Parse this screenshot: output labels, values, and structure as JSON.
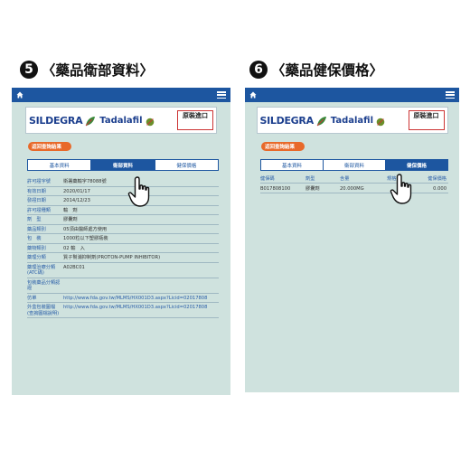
{
  "left_step": {
    "number": "5",
    "title": "〈藥品衛部資料〉"
  },
  "right_step": {
    "number": "6",
    "title": "〈藥品健保價格〉"
  },
  "banner": {
    "brand": "SILDEGRA",
    "product": "Tadalafil",
    "import_label": "原裝進口",
    "accent": "#1c3f8e",
    "import_border": "#cc3333"
  },
  "back_button": {
    "label": "返回查詢結果",
    "color": "#e8692a"
  },
  "tabs": [
    "基本資料",
    "衛部資料",
    "健保價格"
  ],
  "left_panel": {
    "active_tab": 1,
    "rows": [
      {
        "label": "許可證字號",
        "value": "衛署藥輸字78088號"
      },
      {
        "label": "有效日期",
        "value": "2020/01/17"
      },
      {
        "label": "發證日期",
        "value": "2014/12/23"
      },
      {
        "label": "許可證種類",
        "value": "輸　劑"
      },
      {
        "label": "劑　型",
        "value": "膠囊劑"
      },
      {
        "label": "藥品類別",
        "value": "05須由醫師處方使用"
      },
      {
        "label": "包　裝",
        "value": "1000粒以下塑膠瓶裝"
      },
      {
        "label": "藥物類別",
        "value": "02 輸　入"
      },
      {
        "label": "藥理分類",
        "value": "質子幫浦抑制劑(PROTON-PUMP INHIBITOR)"
      },
      {
        "label": "藥理治療分類(ATC碼)",
        "value": "A02BC01"
      },
      {
        "label": "包裝藥品分類認證",
        "value": ""
      },
      {
        "label": "仿單",
        "value": "http://www.fda.gov.tw/MLMS/HX001D3.aspx?Licid=02017808",
        "link": true
      },
      {
        "label": "外盒包裝圖檔(查詢圖檔說明)",
        "value": "http://www.fda.gov.tw/MLMS/HX001D3.aspx?Licid=02017808",
        "link": true
      }
    ]
  },
  "right_panel": {
    "active_tab": 2,
    "headers": [
      "健保碼",
      "劑型",
      "含量",
      "規格量",
      "健保價格"
    ],
    "row": [
      "B017808100",
      "膠囊劑",
      "20.000MG",
      "",
      "0.000"
    ]
  },
  "icons": {
    "home": "home-icon",
    "menu": "hamburger-menu-icon",
    "pointer": "pointing-hand-icon",
    "logo": "leaf-logo-icon"
  },
  "colors": {
    "topbar": "#1d56a0",
    "panel_bg": "#cfe2de",
    "label_text": "#2a5ea8"
  }
}
